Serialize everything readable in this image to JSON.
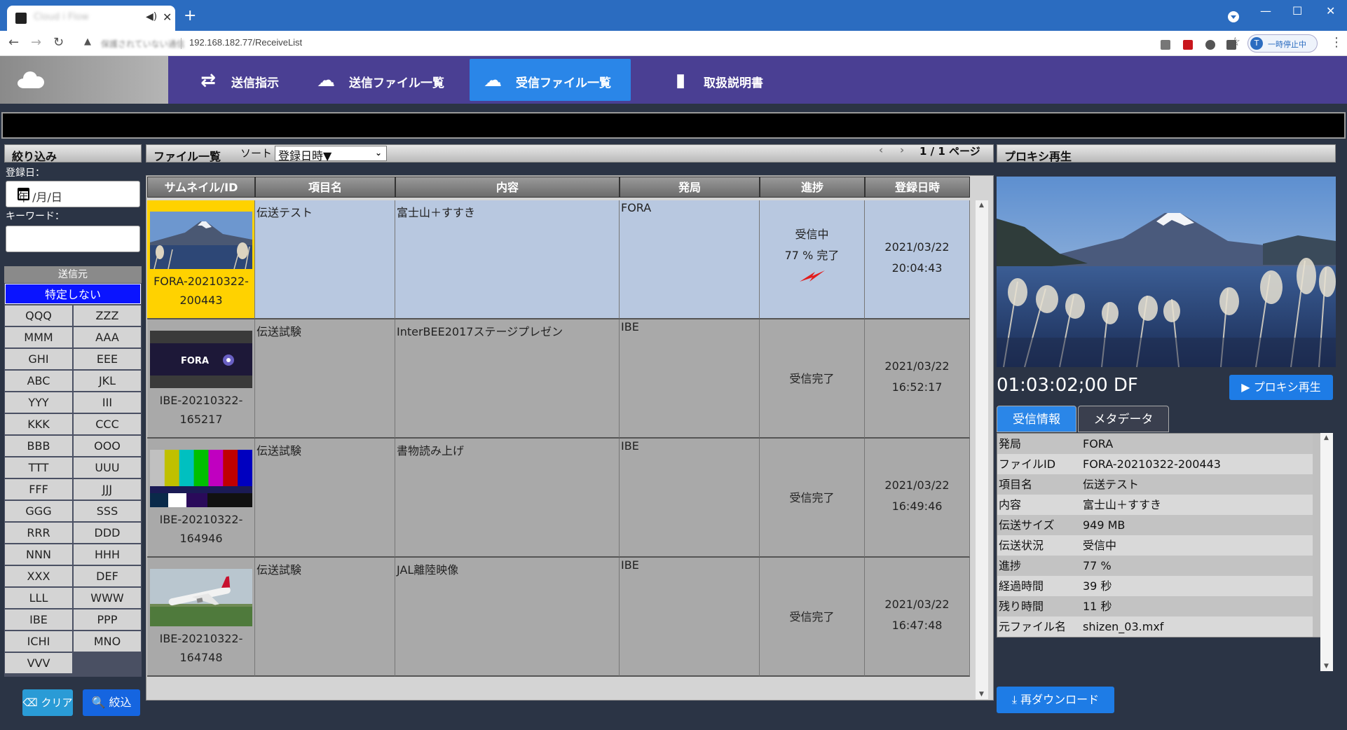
{
  "browser": {
    "tab_title": "Cloud i Flow",
    "url": "192.168.182.77/ReceiveList",
    "security_text": "保護されていない通信",
    "profile_initial": "T",
    "profile_label": "一時停止中"
  },
  "nav": {
    "items": [
      {
        "label": "送信指示",
        "icon": "swap-arrows-icon"
      },
      {
        "label": "送信ファイル一覧",
        "icon": "cloud-upload-icon"
      },
      {
        "label": "受信ファイル一覧",
        "icon": "cloud-download-icon"
      },
      {
        "label": "取扱説明書",
        "icon": "book-icon"
      }
    ],
    "active_index": 2
  },
  "filter": {
    "title": "絞り込み",
    "date_label": "登録日：",
    "date_placeholder": "年 /月/日",
    "keyword_label": "キーワード：",
    "source_header": "送信元",
    "source_all": "特定しない",
    "sources": [
      "QQQ",
      "ZZZ",
      "MMM",
      "AAA",
      "GHI",
      "EEE",
      "ABC",
      "JKL",
      "YYY",
      "III",
      "KKK",
      "CCC",
      "BBB",
      "OOO",
      "TTT",
      "UUU",
      "FFF",
      "JJJ",
      "GGG",
      "SSS",
      "RRR",
      "DDD",
      "NNN",
      "HHH",
      "XXX",
      "DEF",
      "LLL",
      "WWW",
      "IBE",
      "PPP",
      "ICHI",
      "MNO",
      "VVV"
    ],
    "clear_label": "クリア",
    "filter_label": "絞込"
  },
  "filelist": {
    "title": "ファイル一覧",
    "sort_label": "ソート",
    "sort_value": "登録日時▼",
    "pager": "1 / 1 ページ",
    "columns": [
      "サムネイル/ID",
      "項目名",
      "内容",
      "発局",
      "進捗",
      "登録日時"
    ],
    "rows": [
      {
        "id_a": "FORA-20210322-",
        "id_b": "200443",
        "item": "伝送テスト",
        "content": "富士山＋すすき",
        "station": "FORA",
        "progress_a": "受信中",
        "progress_b": "77 % 完了",
        "date": "2021/03/22",
        "time": "20:04:43",
        "thumb": "mountain"
      },
      {
        "id_a": "IBE-20210322-",
        "id_b": "165217",
        "item": "伝送試験",
        "content": "InterBEE2017ステージプレゼン",
        "station": "IBE",
        "progress_a": "受信完了",
        "progress_b": "",
        "date": "2021/03/22",
        "time": "16:52:17",
        "thumb": "fora"
      },
      {
        "id_a": "IBE-20210322-",
        "id_b": "164946",
        "item": "伝送試験",
        "content": "書物読み上げ",
        "station": "IBE",
        "progress_a": "受信完了",
        "progress_b": "",
        "date": "2021/03/22",
        "time": "16:49:46",
        "thumb": "bars"
      },
      {
        "id_a": "IBE-20210322-",
        "id_b": "164748",
        "item": "伝送試験",
        "content": "JAL離陸映像",
        "station": "IBE",
        "progress_a": "受信完了",
        "progress_b": "",
        "date": "2021/03/22",
        "time": "16:47:48",
        "thumb": "plane"
      }
    ],
    "thumb_logo_text": "FORA",
    "row_progress_fraction": 0.77
  },
  "proxy": {
    "title": "プロキシ再生",
    "timecode": "01:03:02;00  DF",
    "play_label": "プロキシ再生",
    "tabs": [
      "受信情報",
      "メタデータ"
    ],
    "info": [
      {
        "k": "発局",
        "v": "FORA"
      },
      {
        "k": "ファイルID",
        "v": "FORA-20210322-200443"
      },
      {
        "k": "項目名",
        "v": "伝送テスト"
      },
      {
        "k": "内容",
        "v": "富士山＋すすき"
      },
      {
        "k": "伝送サイズ",
        "v": "949 MB"
      },
      {
        "k": "伝送状況",
        "v": "受信中"
      },
      {
        "k": "進捗",
        "v": "77 %"
      },
      {
        "k": "経過時間",
        "v": "39 秒"
      },
      {
        "k": "残り時間",
        "v": "11 秒"
      },
      {
        "k": "元ファイル名",
        "v": "shizen_03.mxf"
      }
    ],
    "redownload_label": "再ダウンロード"
  },
  "colors": {
    "header_bg": "#4a3f93",
    "nav_active": "#2a86e8",
    "selected_row": "#b8c8e0",
    "selected_thumb_bg": "#ffd200",
    "row_bg": "#a9a9a9",
    "source_all_bg": "#0a14ff"
  }
}
